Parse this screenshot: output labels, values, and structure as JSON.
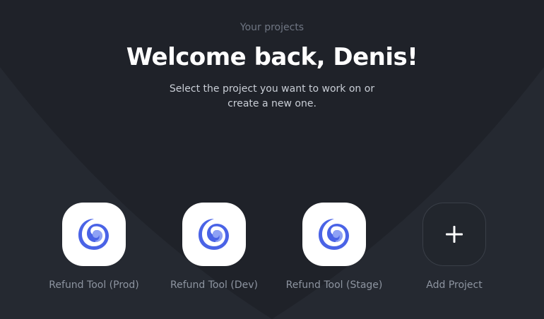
{
  "header": {
    "eyebrow": "Your projects",
    "title": "Welcome back, Denis!",
    "subtitle": "Select the project you want to work on or create a new one."
  },
  "projects": [
    {
      "label": "Refund Tool (Prod)",
      "icon": "spiral-logo-icon"
    },
    {
      "label": "Refund Tool (Dev)",
      "icon": "spiral-logo-icon"
    },
    {
      "label": "Refund Tool (Stage)",
      "icon": "spiral-logo-icon"
    }
  ],
  "add_project": {
    "label": "Add Project",
    "icon": "plus-icon"
  },
  "colors": {
    "background": "#1f2229",
    "tile": "#ffffff",
    "logo_blue": "#4a63e6",
    "logo_light": "#8ea1f5",
    "label": "#8d94a0"
  }
}
